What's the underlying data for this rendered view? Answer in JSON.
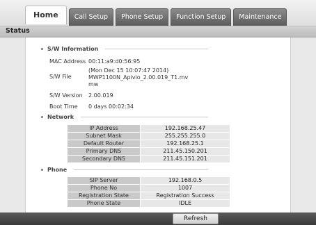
{
  "tabs": [
    {
      "label": "Home"
    },
    {
      "label": "Call Setup"
    },
    {
      "label": "Phone Setup"
    },
    {
      "label": "Function Setup"
    },
    {
      "label": "Maintenance"
    }
  ],
  "page_title": "Status",
  "sw_section": {
    "title": "S/W Information",
    "mac_label": "MAC Address",
    "mac_value": "00:11:a9:d0:56:95",
    "file_label": "S/W File",
    "file_value_line1": "(Mon Dec 15 10:07:47 2014)",
    "file_value_line2": "MWP1100N_Apivio_2.00.019_T1.mv",
    "file_value_line3": "mw",
    "version_label": "S/W Version",
    "version_value": "2.00.019",
    "boot_label": "Boot Time",
    "boot_value": "0 days 00:02:34"
  },
  "network_section": {
    "title": "Network",
    "rows": [
      {
        "label": "IP Address",
        "value": "192.168.25.47"
      },
      {
        "label": "Subnet Mask",
        "value": "255.255.255.0"
      },
      {
        "label": "Default Router",
        "value": "192.168.25.1"
      },
      {
        "label": "Primary DNS",
        "value": "211.45.150.201"
      },
      {
        "label": "Secondary DNS",
        "value": "211.45.151.201"
      }
    ]
  },
  "phone_section": {
    "title": "Phone",
    "rows": [
      {
        "label": "SIP Server",
        "value": "192.168.0.5"
      },
      {
        "label": "Phone No",
        "value": "1007"
      },
      {
        "label": "Registration State",
        "value": "Registration Success"
      },
      {
        "label": "Phone State",
        "value": "IDLE"
      }
    ]
  },
  "refresh_label": "Refresh"
}
